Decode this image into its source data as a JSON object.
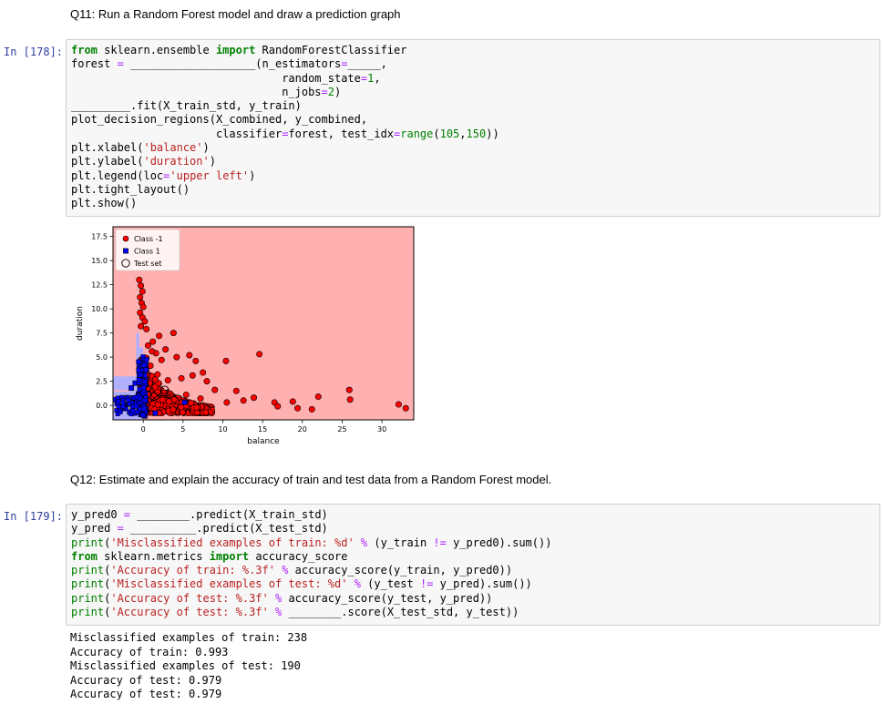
{
  "q11": {
    "heading": "Q11: Run a Random Forest model and draw a prediction graph",
    "prompt": "In [178]:",
    "code": [
      [
        [
          "kw",
          "from"
        ],
        [
          "t",
          " sklearn.ensemble "
        ],
        [
          "kw",
          "import"
        ],
        [
          "t",
          " RandomForestClassifier"
        ]
      ],
      [
        [
          "t",
          "forest "
        ],
        [
          "op",
          "="
        ],
        [
          "t",
          " ___________________(n_estimators"
        ],
        [
          "op",
          "="
        ],
        [
          "t",
          "_____,"
        ]
      ],
      [
        [
          "t",
          "                                random_state"
        ],
        [
          "op",
          "="
        ],
        [
          "num",
          "1"
        ],
        [
          "t",
          ","
        ]
      ],
      [
        [
          "t",
          "                                n_jobs"
        ],
        [
          "op",
          "="
        ],
        [
          "num",
          "2"
        ],
        [
          "t",
          ")"
        ]
      ],
      [
        [
          "t",
          "_________.fit(X_train_std, y_train)"
        ]
      ],
      [
        [
          "t",
          "plot_decision_regions(X_combined, y_combined,"
        ]
      ],
      [
        [
          "t",
          "                      classifier"
        ],
        [
          "op",
          "="
        ],
        [
          "t",
          "forest, test_idx"
        ],
        [
          "op",
          "="
        ],
        [
          "bi",
          "range"
        ],
        [
          "t",
          "("
        ],
        [
          "num",
          "105"
        ],
        [
          "t",
          ","
        ],
        [
          "num",
          "150"
        ],
        [
          "t",
          "))"
        ]
      ],
      [
        [
          "t",
          "plt.xlabel("
        ],
        [
          "str",
          "'balance'"
        ],
        [
          "t",
          ")"
        ]
      ],
      [
        [
          "t",
          "plt.ylabel("
        ],
        [
          "str",
          "'duration'"
        ],
        [
          "t",
          ")"
        ]
      ],
      [
        [
          "t",
          "plt.legend(loc"
        ],
        [
          "op",
          "="
        ],
        [
          "str",
          "'upper left'"
        ],
        [
          "t",
          ")"
        ]
      ],
      [
        [
          "t",
          "plt.tight_layout()"
        ]
      ],
      [
        [
          "t",
          "plt.show()"
        ]
      ]
    ]
  },
  "chart_data": {
    "type": "scatter",
    "xlabel": "balance",
    "ylabel": "duration",
    "xlim": [
      -3.8,
      34
    ],
    "ylim": [
      -1.5,
      18.5
    ],
    "xticks": [
      0,
      5,
      10,
      15,
      20,
      25,
      30
    ],
    "yticks": [
      0.0,
      2.5,
      5.0,
      7.5,
      10.0,
      12.5,
      15.0,
      17.5
    ],
    "legend": {
      "placement": "upper left",
      "entries": [
        "Class -1",
        "Class 1",
        "Test set"
      ]
    },
    "colors": {
      "class_neg": "#ff0000",
      "class_pos": "#0000ff",
      "region_neg": "#ffb0b0",
      "region_pos": "#b0b0ff"
    },
    "series": [
      {
        "name": "Class -1",
        "marker": "circle",
        "points": [
          [
            -0.5,
            13.0
          ],
          [
            -0.3,
            12.4
          ],
          [
            -0.1,
            11.8
          ],
          [
            -0.4,
            11.2
          ],
          [
            -0.2,
            10.6
          ],
          [
            0.0,
            10.2
          ],
          [
            -0.4,
            9.6
          ],
          [
            -0.1,
            9.1
          ],
          [
            0.2,
            8.7
          ],
          [
            -0.3,
            8.2
          ],
          [
            0.4,
            7.9
          ],
          [
            3.8,
            7.5
          ],
          [
            2.0,
            7.2
          ],
          [
            1.2,
            6.6
          ],
          [
            0.6,
            6.2
          ],
          [
            2.8,
            5.8
          ],
          [
            1.6,
            5.4
          ],
          [
            5.8,
            5.2
          ],
          [
            4.2,
            5.0
          ],
          [
            2.3,
            4.7
          ],
          [
            6.6,
            4.6
          ],
          [
            10.4,
            4.6
          ],
          [
            14.6,
            5.3
          ],
          [
            7.5,
            3.4
          ],
          [
            6.2,
            3.1
          ],
          [
            8.0,
            2.5
          ],
          [
            4.8,
            2.8
          ],
          [
            3.1,
            2.6
          ],
          [
            9.0,
            1.6
          ],
          [
            11.7,
            1.5
          ],
          [
            13.9,
            0.8
          ],
          [
            16.5,
            0.3
          ],
          [
            18.8,
            0.4
          ],
          [
            22.0,
            0.9
          ],
          [
            25.9,
            1.6
          ],
          [
            26.0,
            0.6
          ],
          [
            32.1,
            0.1
          ],
          [
            33.0,
            -0.3
          ],
          [
            21.2,
            -0.4
          ],
          [
            19.4,
            -0.3
          ],
          [
            16.9,
            -0.1
          ],
          [
            12.6,
            0.5
          ],
          [
            10.5,
            0.3
          ],
          [
            7.2,
            0.7
          ],
          [
            5.4,
            1.1
          ],
          [
            3.9,
            0.6
          ],
          [
            2.6,
            1.3
          ],
          [
            1.5,
            1.9
          ],
          [
            0.8,
            2.3
          ],
          [
            1.8,
            3.2
          ],
          [
            0.9,
            4.1
          ],
          [
            0.4,
            4.9
          ],
          [
            1.1,
            5.6
          ]
        ]
      },
      {
        "name": "Class 1",
        "marker": "square",
        "points": [
          [
            -3.6,
            0.6
          ],
          [
            -3.2,
            0.2
          ],
          [
            -2.8,
            -0.2
          ],
          [
            -2.4,
            0.1
          ],
          [
            -2.0,
            0.8
          ],
          [
            -1.5,
            1.8
          ],
          [
            -1.0,
            2.3
          ],
          [
            -0.6,
            1.1
          ],
          [
            -0.3,
            3.5
          ],
          [
            -0.2,
            4.6
          ],
          [
            0.0,
            5.0
          ],
          [
            -0.5,
            -0.6
          ],
          [
            -1.7,
            -0.7
          ],
          [
            0.2,
            -1.1
          ],
          [
            1.5,
            -0.8
          ],
          [
            5.2,
            0.3
          ]
        ]
      },
      {
        "name": "Test set",
        "marker": "open-circle",
        "points": [
          [
            0.1,
            4.0
          ],
          [
            1.4,
            0.9
          ],
          [
            2.7,
            1.6
          ]
        ]
      }
    ]
  },
  "q12": {
    "heading": "Q12: Estimate and explain the accuracy of train and test data from a Random Forest model.",
    "prompt": "In [179]:",
    "code": [
      [
        [
          "t",
          "y_pred0 "
        ],
        [
          "op",
          "="
        ],
        [
          "t",
          " ________.predict(X_train_std)"
        ]
      ],
      [
        [
          "t",
          "y_pred "
        ],
        [
          "op",
          "="
        ],
        [
          "t",
          " __________.predict(X_test_std)"
        ]
      ],
      [
        [
          "bi",
          "print"
        ],
        [
          "t",
          "("
        ],
        [
          "str",
          "'Misclassified examples of train: %d'"
        ],
        [
          "t",
          " "
        ],
        [
          "op",
          "%"
        ],
        [
          "t",
          " (y_train "
        ],
        [
          "op",
          "!="
        ],
        [
          "t",
          " y_pred0).sum())"
        ]
      ],
      [
        [
          "kw",
          "from"
        ],
        [
          "t",
          " sklearn.metrics "
        ],
        [
          "kw",
          "import"
        ],
        [
          "t",
          " accuracy_score"
        ]
      ],
      [
        [
          "bi",
          "print"
        ],
        [
          "t",
          "("
        ],
        [
          "str",
          "'Accuracy of train: %.3f'"
        ],
        [
          "t",
          " "
        ],
        [
          "op",
          "%"
        ],
        [
          "t",
          " accuracy_score(y_train, y_pred0))"
        ]
      ],
      [
        [
          "bi",
          "print"
        ],
        [
          "t",
          "("
        ],
        [
          "str",
          "'Misclassified examples of test: %d'"
        ],
        [
          "t",
          " "
        ],
        [
          "op",
          "%"
        ],
        [
          "t",
          " (y_test "
        ],
        [
          "op",
          "!="
        ],
        [
          "t",
          " y_pred).sum())"
        ]
      ],
      [
        [
          "bi",
          "print"
        ],
        [
          "t",
          "("
        ],
        [
          "str",
          "'Accuracy of test: %.3f'"
        ],
        [
          "t",
          " "
        ],
        [
          "op",
          "%"
        ],
        [
          "t",
          " accuracy_score(y_test, y_pred))"
        ]
      ],
      [
        [
          "bi",
          "print"
        ],
        [
          "t",
          "("
        ],
        [
          "str",
          "'Accuracy of test: %.3f'"
        ],
        [
          "t",
          " "
        ],
        [
          "op",
          "%"
        ],
        [
          "t",
          " ________.score(X_test_std, y_test))"
        ]
      ]
    ],
    "output": [
      "Misclassified examples of train: 238",
      "Accuracy of train: 0.993",
      "Misclassified examples of test: 190",
      "Accuracy of test: 0.979",
      "Accuracy of test: 0.979"
    ]
  }
}
